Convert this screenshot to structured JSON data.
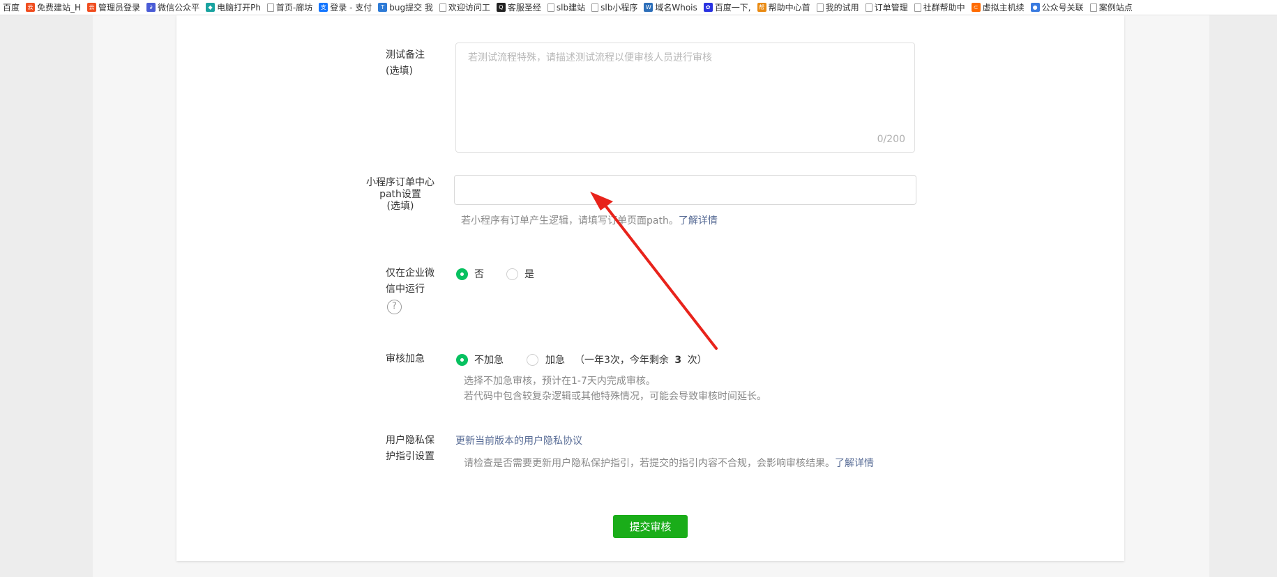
{
  "bookmarks": [
    {
      "label": "百度",
      "icon": "none"
    },
    {
      "label": "免费建站_H",
      "icon": "site-logo-icon"
    },
    {
      "label": "管理员登录",
      "icon": "site-logo-icon"
    },
    {
      "label": "微信公众平",
      "icon": "wechat-link-icon"
    },
    {
      "label": "电脑打开Ph",
      "icon": "diamond-icon"
    },
    {
      "label": "首页-廊坊",
      "icon": "page-icon"
    },
    {
      "label": "登录 - 支付",
      "icon": "alipay-icon"
    },
    {
      "label": "bug提交 我",
      "icon": "tower-icon"
    },
    {
      "label": "欢迎访问工",
      "icon": "page-icon"
    },
    {
      "label": "客服圣经",
      "icon": "qq-icon"
    },
    {
      "label": "slb建站",
      "icon": "page-icon"
    },
    {
      "label": "slb小程序",
      "icon": "page-icon"
    },
    {
      "label": "域名Whois",
      "icon": "whois-icon"
    },
    {
      "label": "百度一下,",
      "icon": "baidu-paw-icon"
    },
    {
      "label": "帮助中心首",
      "icon": "help-center-icon"
    },
    {
      "label": "我的试用",
      "icon": "page-icon"
    },
    {
      "label": "订单管理",
      "icon": "page-icon"
    },
    {
      "label": "社群帮助中",
      "icon": "page-icon"
    },
    {
      "label": "虚拟主机续",
      "icon": "aliyun-icon"
    },
    {
      "label": "公众号关联",
      "icon": "chrome-icon"
    },
    {
      "label": "案例站点",
      "icon": "page-icon"
    }
  ],
  "form": {
    "test_notes": {
      "label_line1": "测试备注",
      "label_line2": "(选填)",
      "placeholder": "若测试流程特殊，请描述测试流程以便审核人员进行审核",
      "counter": "0/200"
    },
    "order_path": {
      "label_line1": "小程序订单中心",
      "label_line2": "path设置",
      "label_line3": "(选填)",
      "value": "",
      "hint": "若小程序有订单产生逻辑，请填写订单页面path。",
      "hint_link": "了解详情"
    },
    "wecom_only": {
      "label_line1": "仅在企业微",
      "label_line2": "信中运行",
      "help_glyph": "?",
      "options": [
        "否",
        "是"
      ],
      "selected": "否"
    },
    "expedite": {
      "label": "审核加急",
      "options": [
        "不加急",
        "加急"
      ],
      "selected": "不加急",
      "quota_prefix": "（一年3次，今年剩余",
      "quota_value": "3",
      "quota_suffix": "次）",
      "hint_line1": "选择不加急审核，预计在1-7天内完成审核。",
      "hint_line2": "若代码中包含较复杂逻辑或其他特殊情况，可能会导致审核时间延长。"
    },
    "privacy": {
      "label_line1": "用户隐私保",
      "label_line2": "护指引设置",
      "link": "更新当前版本的用户隐私协议",
      "hint": "请检查是否需要更新用户隐私保护指引，若提交的指引内容不合规，会影响审核结果。",
      "hint_link": "了解详情"
    },
    "submit_label": "提交审核"
  },
  "colors": {
    "accent_green": "#07c160",
    "button_green": "#1aad19",
    "link_blue": "#576b95",
    "annotation_arrow": "#e8231b"
  }
}
